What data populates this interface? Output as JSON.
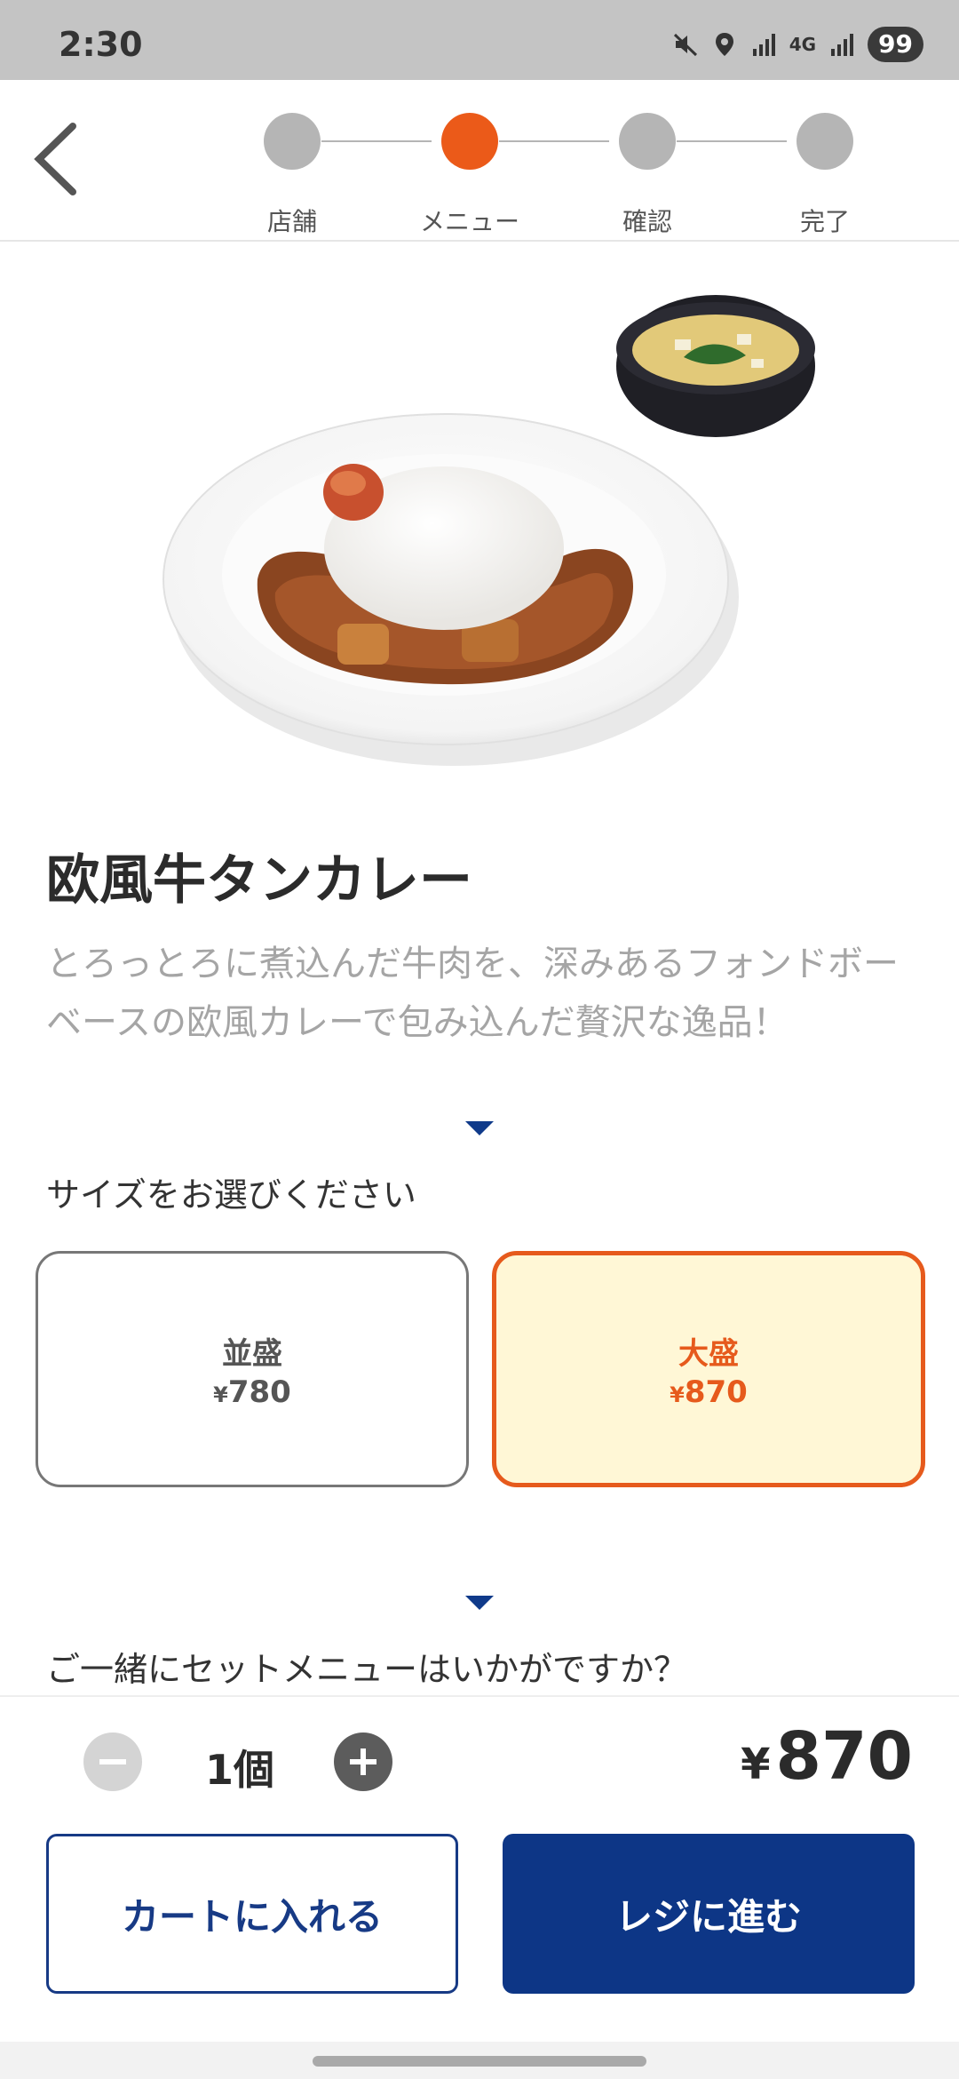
{
  "status": {
    "time": "2:30",
    "battery": "99",
    "network": "4G"
  },
  "stepper": {
    "steps": [
      {
        "label": "店舗",
        "active": false
      },
      {
        "label": "メニュー",
        "active": true
      },
      {
        "label": "確認",
        "active": false
      },
      {
        "label": "完了",
        "active": false
      }
    ]
  },
  "product": {
    "name": "欧風牛タンカレー",
    "description": "とろっとろに煮込んだ牛肉を、深みあるフォンドボーベースの欧風カレーで包み込んだ贅沢な逸品！"
  },
  "size_section": {
    "label": "サイズをお選びください",
    "options": [
      {
        "name": "並盛",
        "currency": "¥",
        "price": "780",
        "selected": false
      },
      {
        "name": "大盛",
        "currency": "¥",
        "price": "870",
        "selected": true
      }
    ]
  },
  "set_section": {
    "label": "ご一緒にセットメニューはいかがですか？"
  },
  "order": {
    "quantity": "1個",
    "currency": "¥",
    "total": "870",
    "add_to_cart": "カートに入れる",
    "checkout": "レジに進む"
  },
  "colors": {
    "accent": "#eb5a19",
    "primary": "#0d3686",
    "selected_bg": "#fff7d6"
  }
}
